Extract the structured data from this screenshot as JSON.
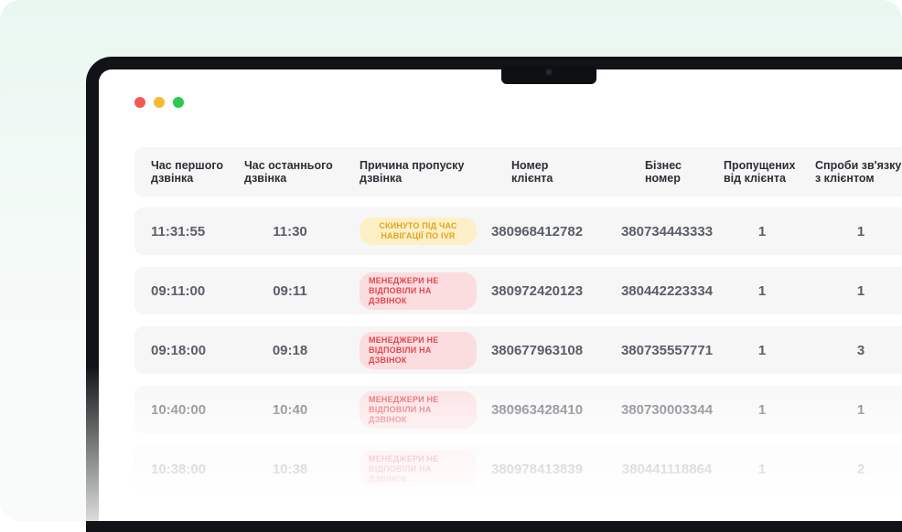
{
  "colors": {
    "accent_bg": "#e9f7f1",
    "badge_yellow_bg": "#fdf0c6",
    "badge_yellow_text": "#e3a21a",
    "badge_red_bg": "#fbdde0",
    "badge_red_text": "#e1484e"
  },
  "window": {
    "controls": [
      "close-dot",
      "minimize-dot",
      "maximize-dot"
    ]
  },
  "table": {
    "headers": [
      "Час першого дзвінка",
      "Час останнього дзвінка",
      "Причина пропуску дзвінка",
      "Номер клієнта",
      "Бізнес номер",
      "Пропущених від клієнта",
      "Спроби зв'язку з клієнтом"
    ],
    "rows": [
      {
        "first_call": "11:31:55",
        "last_call": "11:30",
        "reason": "СКИНУТО ПІД ЧАС НАВІГАЦІЇ ПО IVR",
        "reason_type": "yellow",
        "client_number": "380968412782",
        "business_number": "380734443333",
        "missed": "1",
        "attempts": "1"
      },
      {
        "first_call": "09:11:00",
        "last_call": "09:11",
        "reason": "МЕНЕДЖЕРИ НЕ ВІДПОВІЛИ НА ДЗВІНОК",
        "reason_type": "red",
        "client_number": "380972420123",
        "business_number": "380442223334",
        "missed": "1",
        "attempts": "1"
      },
      {
        "first_call": "09:18:00",
        "last_call": "09:18",
        "reason": "МЕНЕДЖЕРИ НЕ ВІДПОВІЛИ НА ДЗВІНОК",
        "reason_type": "red",
        "client_number": "380677963108",
        "business_number": "380735557771",
        "missed": "1",
        "attempts": "3"
      },
      {
        "first_call": "10:40:00",
        "last_call": "10:40",
        "reason": "МЕНЕДЖЕРИ НЕ ВІДПОВІЛИ НА ДЗВІНОК",
        "reason_type": "red",
        "client_number": "380963428410",
        "business_number": "380730003344",
        "missed": "1",
        "attempts": "1"
      },
      {
        "first_call": "10:38:00",
        "last_call": "10:38",
        "reason": "МЕНЕДЖЕРИ НЕ ВІДПОВІЛИ НА ДЗВІНОК",
        "reason_type": "red",
        "client_number": "380978413839",
        "business_number": "380441118864",
        "missed": "1",
        "attempts": "2"
      }
    ]
  }
}
